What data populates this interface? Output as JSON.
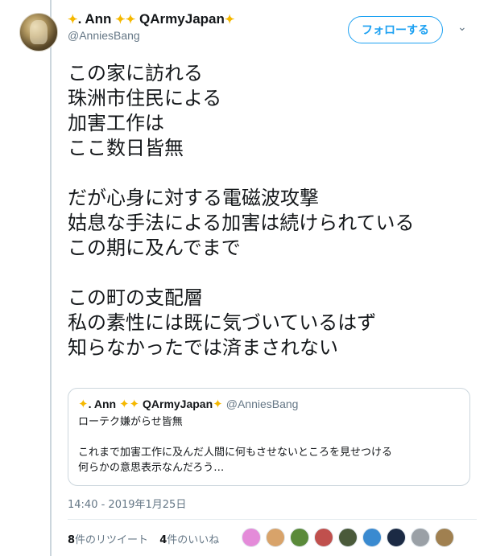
{
  "tweet": {
    "display_name": ". Ann ",
    "display_name_tail": " QArmyJapan",
    "handle": "@AnniesBang",
    "follow_label": "フォローする",
    "text_paragraphs": [
      [
        "この家に訪れる",
        "珠洲市住民による",
        "加害工作は",
        "ここ数日皆無"
      ],
      [
        "だが心身に対する電磁波攻撃",
        "姑息な手法による加害は続けられている",
        "この期に及んでまで"
      ],
      [
        "この町の支配層",
        "私の素性には既に気づいているはず",
        "知らなかったでは済まされない"
      ]
    ],
    "quote": {
      "display_name": ". Ann ",
      "display_name_tail": " QArmyJapan",
      "handle": "@AnniesBang",
      "line1": "ローテク嫌がらせ皆無",
      "line2": "これまで加害工作に及んだ人間に何もさせないところを見せつける",
      "line3": "何らかの意思表示なんだろう…"
    },
    "timestamp": "14:40 - 2019年1月25日",
    "retweets_count": "8",
    "retweets_label": "件のリツイート",
    "likes_count": "4",
    "likes_label": "件のいいね"
  },
  "colors": {
    "accent": "#1da1f2",
    "secondary_text": "#657786",
    "star": "#f5b800",
    "thread_line": "#ccd6dd"
  },
  "liker_avatars": [
    {
      "name": "liker-avatar-1",
      "color": "#e48bd9"
    },
    {
      "name": "liker-avatar-2",
      "color": "#d8a36a"
    },
    {
      "name": "liker-avatar-3",
      "color": "#5a8a3a"
    },
    {
      "name": "liker-avatar-4",
      "color": "#c0504d"
    },
    {
      "name": "liker-avatar-5",
      "color": "#4a5a3a"
    },
    {
      "name": "liker-avatar-6",
      "color": "#3a8ad0"
    },
    {
      "name": "liker-avatar-7",
      "color": "#1b2a44"
    },
    {
      "name": "liker-avatar-8",
      "color": "#9aa0a6"
    },
    {
      "name": "liker-avatar-9",
      "color": "#a08050"
    }
  ]
}
